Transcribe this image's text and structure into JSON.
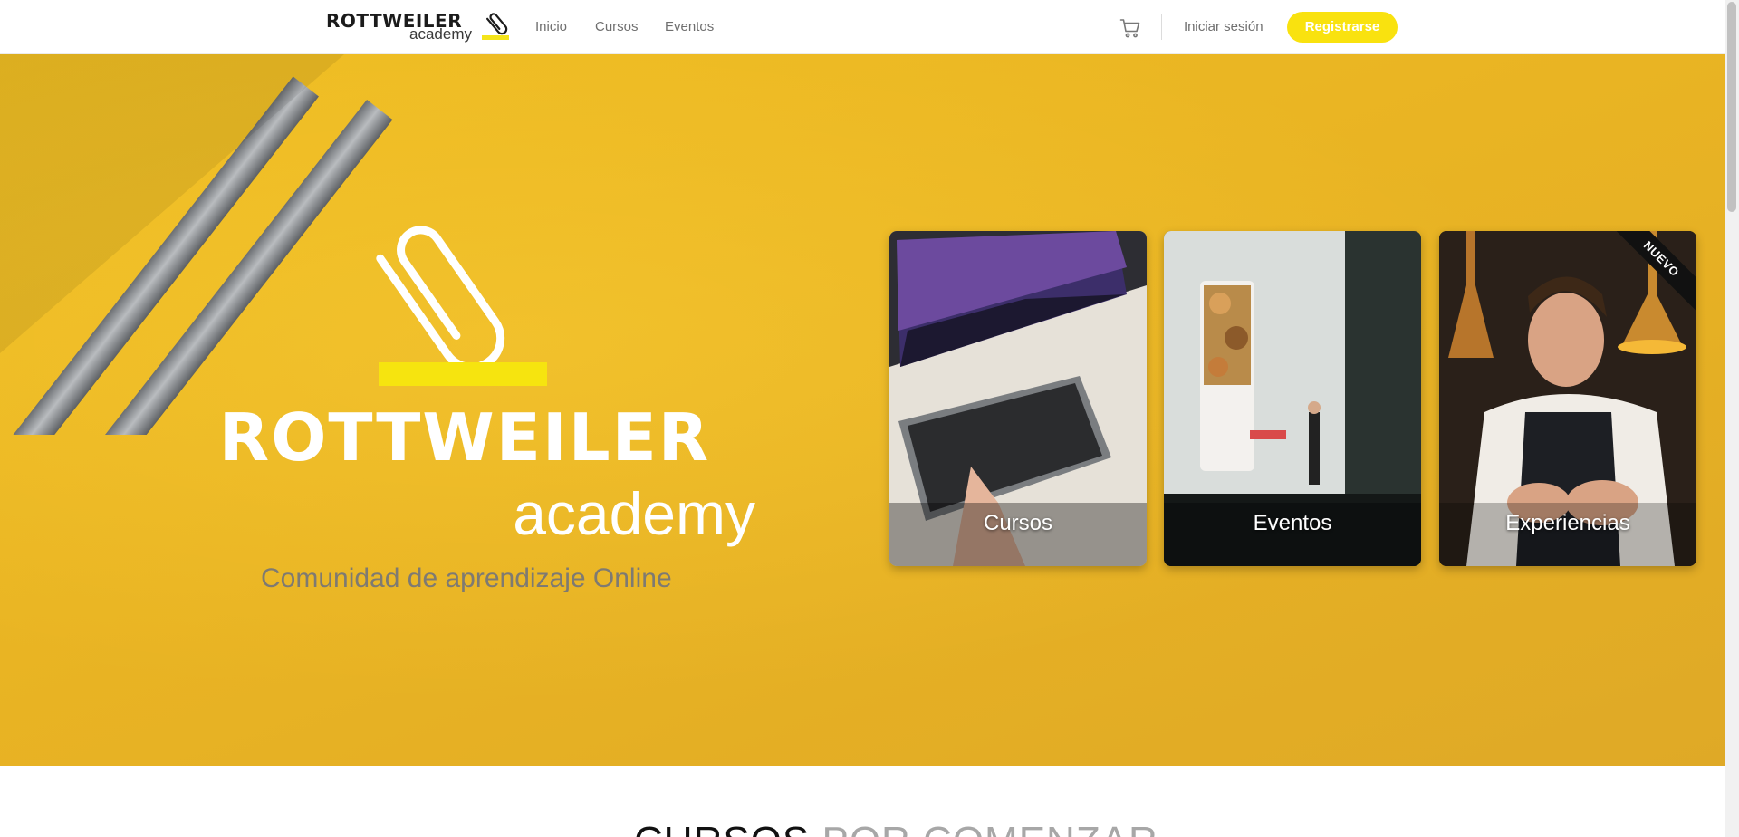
{
  "navbar": {
    "brand_word": "ROTTWEILER",
    "brand_sub": "academy",
    "links": [
      "Inicio",
      "Cursos",
      "Eventos"
    ],
    "login_label": "Iniciar sesión",
    "register_label": "Registrarse"
  },
  "hero": {
    "logo_word": "ROTTWEILER",
    "logo_sub": "academy",
    "tagline": "Comunidad de aprendizaje Online",
    "cards": [
      {
        "label": "Cursos"
      },
      {
        "label": "Eventos"
      },
      {
        "label": "Experiencias",
        "badge": "NUEVO"
      }
    ]
  },
  "section": {
    "title_dark": "CURSOS",
    "title_light": "POR COMENZAR"
  },
  "colors": {
    "accent_yellow": "#f9e20f",
    "hero_yellow": "#e9b423",
    "text_gray": "#6f6f6f"
  },
  "icons": [
    "paperclip-icon",
    "cart-icon"
  ]
}
